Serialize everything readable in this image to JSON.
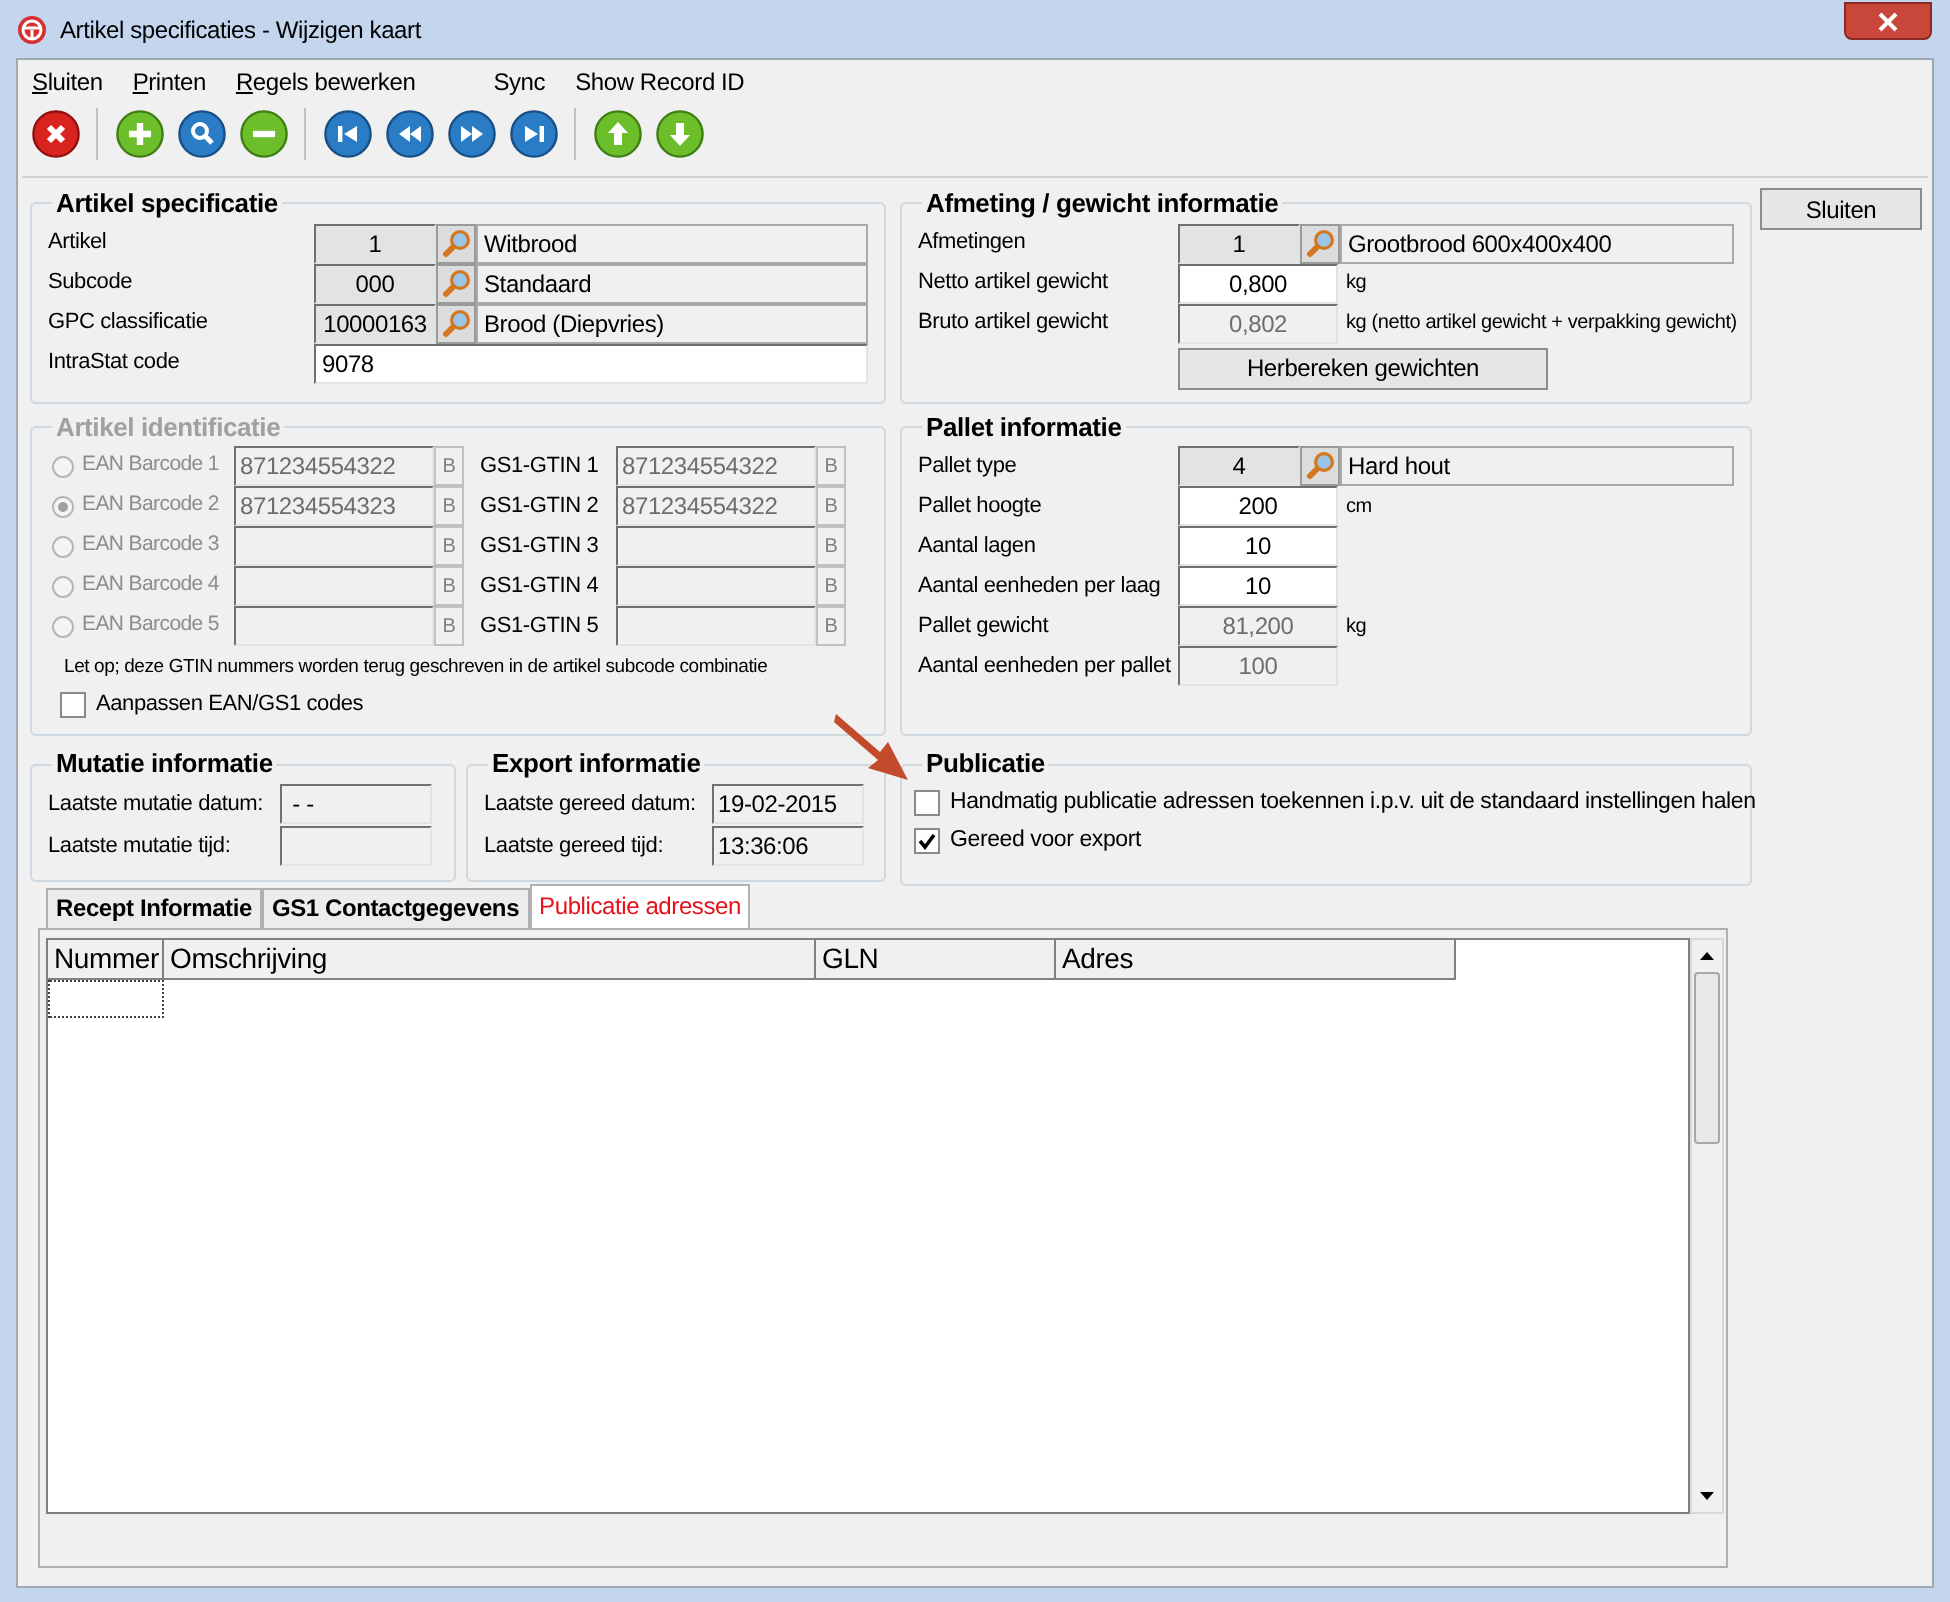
{
  "window": {
    "title": "Artikel specificaties - Wijzigen kaart"
  },
  "menu": [
    {
      "label": "Sluiten",
      "underlined": true
    },
    {
      "label": "Printen",
      "underlined": true
    },
    {
      "label": "Regels bewerken",
      "underlined": true
    },
    {
      "label": "Sync",
      "underlined": false
    },
    {
      "label": "Show Record ID",
      "underlined": false
    }
  ],
  "toolbar": [
    [
      {
        "kind": "delete"
      }
    ],
    [
      {
        "kind": "add"
      },
      {
        "kind": "search"
      },
      {
        "kind": "remove"
      }
    ],
    [
      {
        "kind": "first"
      },
      {
        "kind": "previous"
      },
      {
        "kind": "next"
      },
      {
        "kind": "last"
      }
    ],
    [
      {
        "kind": "up"
      },
      {
        "kind": "down"
      }
    ]
  ],
  "close_button": "Sluiten",
  "artikel_specificatie": {
    "title": "Artikel specificatie",
    "rows": [
      {
        "kind": "lookup",
        "label": "Artikel",
        "code": "1",
        "description": "Witbrood"
      },
      {
        "kind": "lookup",
        "label": "Subcode",
        "code": "000",
        "description": "Standaard"
      },
      {
        "kind": "lookup",
        "label": "GPC classificatie",
        "code": "10000163",
        "description": "Brood (Diepvries)"
      },
      {
        "kind": "wide",
        "label": "IntraStat code",
        "value": "9078"
      }
    ]
  },
  "afmeting": {
    "title": "Afmeting / gewicht informatie",
    "rows": [
      {
        "kind": "lookup",
        "label": "Afmetingen",
        "code": "1",
        "description": "Grootbrood 600x400x400"
      },
      {
        "kind": "input",
        "label": "Netto artikel gewicht",
        "value": "0,800",
        "unit": "kg"
      },
      {
        "kind": "readonly",
        "label": "Bruto artikel gewicht",
        "value": "0,802",
        "unit": "kg (netto artikel gewicht + verpakking gewicht)"
      }
    ],
    "button": "Herbereken gewichten"
  },
  "artikel_identificatie": {
    "title": "Artikel identificatie",
    "disabled": true,
    "rows": [
      {
        "ean_label": "EAN Barcode 1",
        "ean_selected": false,
        "ean_value": "871234554322",
        "b": "B",
        "gtin_label": "GS1-GTIN 1",
        "gtin_value": "871234554322",
        "gtin_b": "B"
      },
      {
        "ean_label": "EAN Barcode 2",
        "ean_selected": true,
        "ean_value": "871234554323",
        "b": "B",
        "gtin_label": "GS1-GTIN 2",
        "gtin_value": "871234554322",
        "gtin_b": "B"
      },
      {
        "ean_label": "EAN Barcode 3",
        "ean_selected": false,
        "b": "B",
        "gtin_label": "GS1-GTIN 3",
        "gtin_b": "B"
      },
      {
        "ean_label": "EAN Barcode 4",
        "ean_selected": false,
        "b": "B",
        "gtin_label": "GS1-GTIN 4",
        "gtin_b": "B"
      },
      {
        "ean_label": "EAN Barcode 5",
        "ean_selected": false,
        "b": "B",
        "gtin_label": "GS1-GTIN 5",
        "gtin_b": "B"
      }
    ],
    "note": "Let op; deze GTIN nummers worden terug geschreven in de artikel subcode combinatie",
    "checkbox": {
      "label": "Aanpassen EAN/GS1 codes",
      "checked": false
    }
  },
  "pallet": {
    "title": "Pallet informatie",
    "rows": [
      {
        "kind": "lookup",
        "label": "Pallet type",
        "code": "4",
        "description": "Hard hout"
      },
      {
        "kind": "input",
        "label": "Pallet hoogte",
        "value": "200",
        "unit": "cm"
      },
      {
        "kind": "input",
        "label": "Aantal lagen",
        "value": "10"
      },
      {
        "kind": "input",
        "label": "Aantal eenheden per laag",
        "value": "10"
      },
      {
        "kind": "readonly",
        "label": "Pallet gewicht",
        "value": "81,200",
        "unit": "kg"
      },
      {
        "kind": "readonly",
        "label": "Aantal eenheden per pallet",
        "value": "100"
      }
    ]
  },
  "mutatie": {
    "title": "Mutatie informatie",
    "rows": [
      {
        "label": "Laatste mutatie datum:",
        "value": " - -"
      },
      {
        "label": "Laatste mutatie tijd:"
      }
    ]
  },
  "export": {
    "title": "Export informatie",
    "rows": [
      {
        "label": "Laatste gereed datum:",
        "value": "19-02-2015"
      },
      {
        "label": "Laatste gereed tijd:",
        "value": "13:36:06"
      }
    ]
  },
  "publicatie": {
    "title": "Publicatie",
    "checkboxes": [
      {
        "label": "Handmatig publicatie adressen toekennen i.p.v. uit de standaard instellingen halen",
        "checked": false
      },
      {
        "label": "Gereed voor export",
        "checked": true
      }
    ]
  },
  "tabs": [
    {
      "label": "Recept Informatie",
      "selected": false
    },
    {
      "label": "GS1 Contactgegevens",
      "selected": false
    },
    {
      "label": "Publicatie adressen",
      "selected": true
    }
  ],
  "table": {
    "columns": [
      "Nummer",
      "Omschrijving",
      "GLN",
      "Adres"
    ]
  }
}
